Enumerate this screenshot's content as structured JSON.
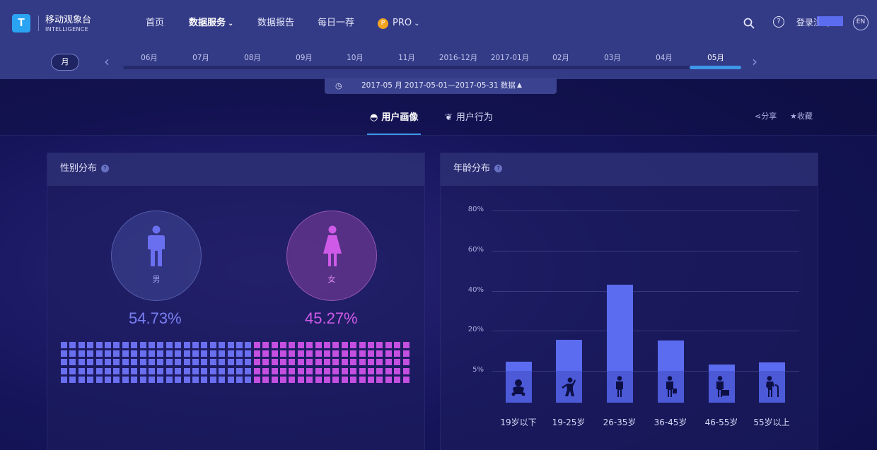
{
  "brand": {
    "logo_letter": "T",
    "name": "移动观象台",
    "sub": "INTELLIGENCE"
  },
  "nav": {
    "home": "首页",
    "data_service": "数据服务",
    "data_report": "数据报告",
    "daily_pick": "每日一荐",
    "pro_badge": "P",
    "pro": "PRO"
  },
  "header_right": {
    "login": "登录",
    "register": "注册",
    "lang": "EN",
    "help": "?"
  },
  "timeline": {
    "mode": "月",
    "labels": [
      "06月",
      "07月",
      "08月",
      "09月",
      "10月",
      "11月",
      "2016-12月",
      "2017-01月",
      "02月",
      "03月",
      "04月",
      "05月"
    ],
    "selected_index": 11
  },
  "date_range": "2017-05 月 2017-05-01—2017-05-31  数据",
  "tabs": {
    "profile": "用户画像",
    "behavior": "用户行为"
  },
  "actions": {
    "share": "分享",
    "favorite": "收藏"
  },
  "gender": {
    "title": "性别分布",
    "male_label": "男",
    "female_label": "女",
    "male_pct": "54.73%",
    "female_pct": "45.27%",
    "colors": {
      "male": "#6a6ff0",
      "female": "#c44fe0"
    }
  },
  "age": {
    "title": "年龄分布",
    "chart_data": {
      "type": "bar",
      "categories": [
        "19岁以下",
        "19-25岁",
        "26-35岁",
        "36-45岁",
        "46-55岁",
        "55岁以上"
      ],
      "values": [
        8.5,
        16.5,
        43,
        16.2,
        7.5,
        8.2
      ],
      "y_ticks": [
        "80%",
        "60%",
        "40%",
        "20%",
        "5%"
      ],
      "icons": [
        "baby-icon",
        "youth-icon",
        "adult-icon",
        "businessman-icon",
        "office-worker-icon",
        "elderly-icon"
      ],
      "bar_color": "#5c6cf0"
    }
  }
}
